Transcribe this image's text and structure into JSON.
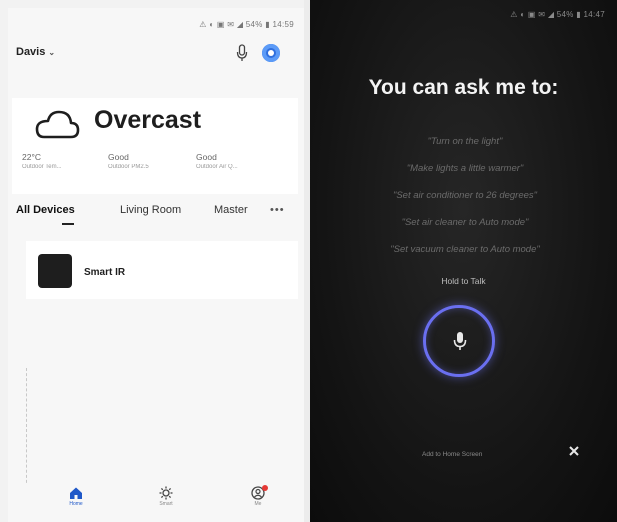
{
  "left_screen": {
    "status_bar": "⚠ ◐ ▣ ✉ ◢ 54% ▮ 14:59",
    "header": {
      "user_name": "Davis",
      "chevron": "⌄"
    },
    "weather": {
      "condition": "Overcast",
      "stats": [
        {
          "value": "22°C",
          "label": "Outdoor Tem..."
        },
        {
          "value": "Good",
          "label": "Outdoor PM2.5"
        },
        {
          "value": "Good",
          "label": "Outdoor Air Q..."
        }
      ]
    },
    "room_tabs": [
      "All Devices",
      "Living Room",
      "Master"
    ],
    "more_glyph": "•••",
    "devices": [
      {
        "name": "Smart IR"
      }
    ],
    "bottom_nav": [
      {
        "label": "Home",
        "icon": "home-icon",
        "active": true
      },
      {
        "label": "Smart",
        "icon": "smart-icon",
        "active": false
      },
      {
        "label": "Me",
        "icon": "me-icon",
        "active": false
      }
    ],
    "colors": {
      "accent": "#2f6fde",
      "badge": "#e53935"
    }
  },
  "right_screen": {
    "status_bar": "⚠ ◐ ▣ ✉ ◢ 54% ▮ 14:47",
    "title": "You can ask me to:",
    "suggestions": [
      "\"Turn on the light\"",
      "\"Make lights a little warmer\"",
      "\"Set air conditioner to 26 degrees\"",
      "\"Set air cleaner to Auto mode\"",
      "\"Set vacuum cleaner to Auto mode\""
    ],
    "hold_to_talk": "Hold to Talk",
    "add_to_home": "Add to Home Screen",
    "colors": {
      "mic_ring": "#6a6ff0",
      "background": "#141414"
    }
  }
}
